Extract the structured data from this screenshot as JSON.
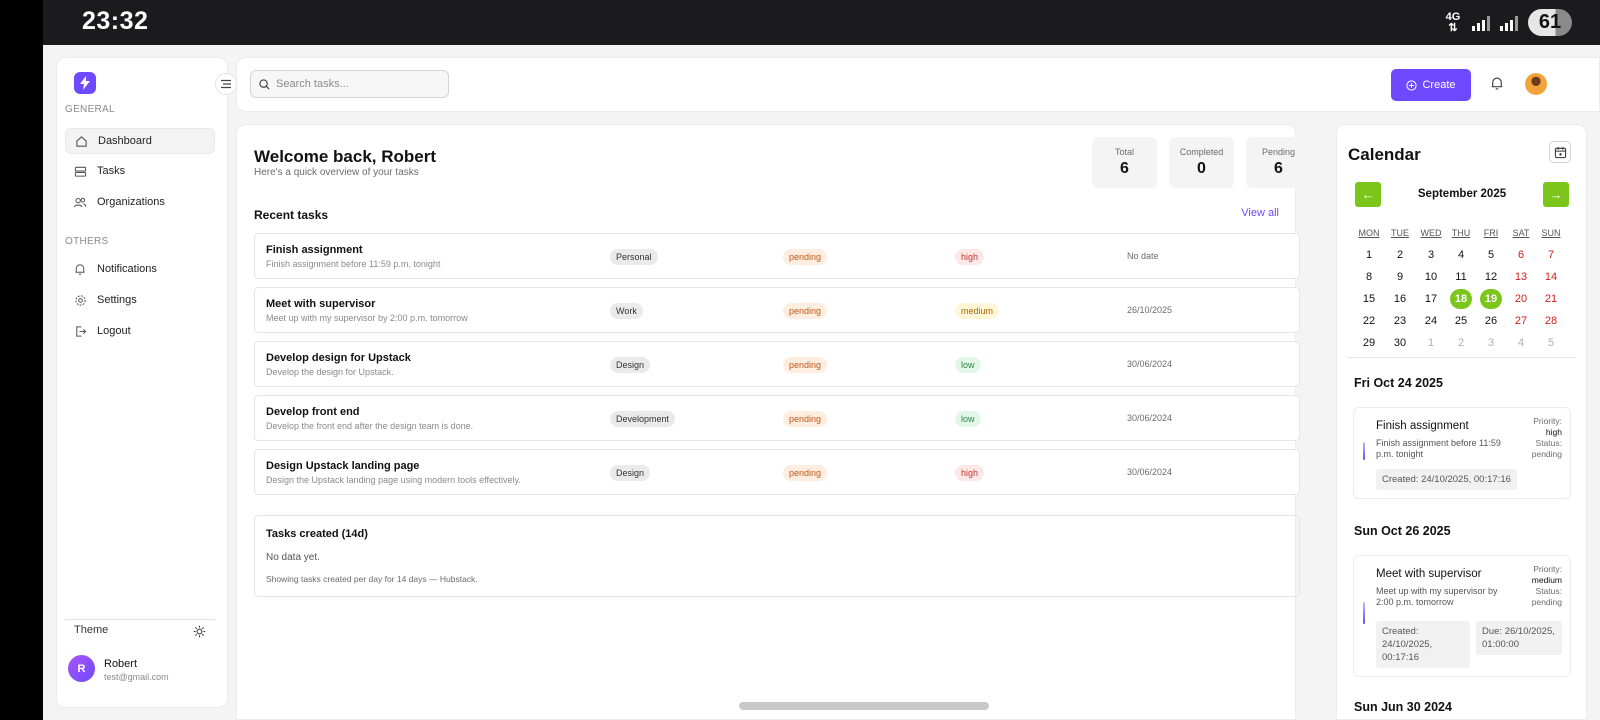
{
  "status_bar": {
    "time": "23:32",
    "network": "4G",
    "battery": "61"
  },
  "sidebar": {
    "general_label": "GENERAL",
    "others_label": "OTHERS",
    "general_items": [
      {
        "label": "Dashboard",
        "icon": "home-icon",
        "active": true
      },
      {
        "label": "Tasks",
        "icon": "tasks-icon"
      },
      {
        "label": "Organizations",
        "icon": "users-icon"
      }
    ],
    "other_items": [
      {
        "label": "Notifications",
        "icon": "bell-icon"
      },
      {
        "label": "Settings",
        "icon": "gear-icon"
      },
      {
        "label": "Logout",
        "icon": "logout-icon"
      }
    ],
    "theme_label": "Theme",
    "user": {
      "initial": "R",
      "name": "Robert",
      "email": "test@gmail.com"
    }
  },
  "topbar": {
    "search_placeholder": "Search tasks...",
    "create_label": "Create"
  },
  "main": {
    "welcome": "Welcome back, Robert",
    "subtitle": "Here's a quick overview of your tasks",
    "stats": [
      {
        "label": "Total",
        "value": "6"
      },
      {
        "label": "Completed",
        "value": "0"
      },
      {
        "label": "Pending",
        "value": "6"
      }
    ],
    "recent_title": "Recent tasks",
    "view_all": "View all",
    "tasks": [
      {
        "title": "Finish assignment",
        "desc": "Finish assignment before 11:59 p.m. tonight",
        "category": "Personal",
        "status": "pending",
        "priority": "high",
        "due": "No date"
      },
      {
        "title": "Meet with supervisor",
        "desc": "Meet up with my supervisor by 2:00 p.m. tomorrow",
        "category": "Work",
        "status": "pending",
        "priority": "medium",
        "due": "26/10/2025"
      },
      {
        "title": "Develop design for Upstack",
        "desc": "Develop the design for Upstack.",
        "category": "Design",
        "status": "pending",
        "priority": "low",
        "due": "30/06/2024"
      },
      {
        "title": "Develop front end",
        "desc": "Develop the front end after the design team is done.",
        "category": "Development",
        "status": "pending",
        "priority": "low",
        "due": "30/06/2024"
      },
      {
        "title": "Design Upstack landing page",
        "desc": "Design the Upstack landing page using modern tools effectively.",
        "category": "Design",
        "status": "pending",
        "priority": "high",
        "due": "30/06/2024"
      }
    ],
    "chart_card": {
      "title": "Tasks created (14d)",
      "empty": "No data yet.",
      "footer": "Showing tasks created per day for 14 days — Hubstack."
    }
  },
  "calendar": {
    "title": "Calendar",
    "prev": "←",
    "next": "→",
    "month": "September 2025",
    "weekdays": [
      "MON",
      "TUE",
      "WED",
      "THU",
      "FRI",
      "SAT",
      "SUN"
    ],
    "weeks": [
      [
        {
          "d": "1"
        },
        {
          "d": "2"
        },
        {
          "d": "3"
        },
        {
          "d": "4"
        },
        {
          "d": "5"
        },
        {
          "d": "6",
          "w": true
        },
        {
          "d": "7",
          "w": true
        }
      ],
      [
        {
          "d": "8"
        },
        {
          "d": "9"
        },
        {
          "d": "10"
        },
        {
          "d": "11"
        },
        {
          "d": "12"
        },
        {
          "d": "13",
          "w": true
        },
        {
          "d": "14",
          "w": true
        }
      ],
      [
        {
          "d": "15"
        },
        {
          "d": "16"
        },
        {
          "d": "17"
        },
        {
          "d": "18",
          "sel": true
        },
        {
          "d": "19",
          "sel": true
        },
        {
          "d": "20",
          "w": true
        },
        {
          "d": "21",
          "w": true
        }
      ],
      [
        {
          "d": "22"
        },
        {
          "d": "23"
        },
        {
          "d": "24"
        },
        {
          "d": "25"
        },
        {
          "d": "26"
        },
        {
          "d": "27",
          "w": true
        },
        {
          "d": "28",
          "w": true
        }
      ],
      [
        {
          "d": "29"
        },
        {
          "d": "30"
        },
        {
          "d": "1",
          "o": true
        },
        {
          "d": "2",
          "o": true
        },
        {
          "d": "3",
          "o": true
        },
        {
          "d": "4",
          "o": true
        },
        {
          "d": "5",
          "o": true
        }
      ]
    ],
    "groups": [
      {
        "date": "Fri Oct 24 2025",
        "event": {
          "title": "Finish assignment",
          "desc": "Finish assignment before 11:59 p.m. tonight",
          "priority_label": "Priority:",
          "priority": "high",
          "status_label": "Status:",
          "status": "pending",
          "created": "Created: 24/10/2025, 00:17:16"
        }
      },
      {
        "date": "Sun Oct 26 2025",
        "event": {
          "title": "Meet with supervisor",
          "desc": "Meet up with my supervisor by 2:00 p.m. tomorrow",
          "priority_label": "Priority:",
          "priority": "medium",
          "status_label": "Status:",
          "status": "pending",
          "created": "Created: 24/10/2025, 00:17:16",
          "due": "Due: 26/10/2025, 01:00:00"
        }
      },
      {
        "date": "Sun Jun 30 2024"
      }
    ]
  },
  "colors": {
    "accent": "#6d4aff",
    "calendar_green": "#7cc51a",
    "weekend_red": "#d0211c"
  }
}
